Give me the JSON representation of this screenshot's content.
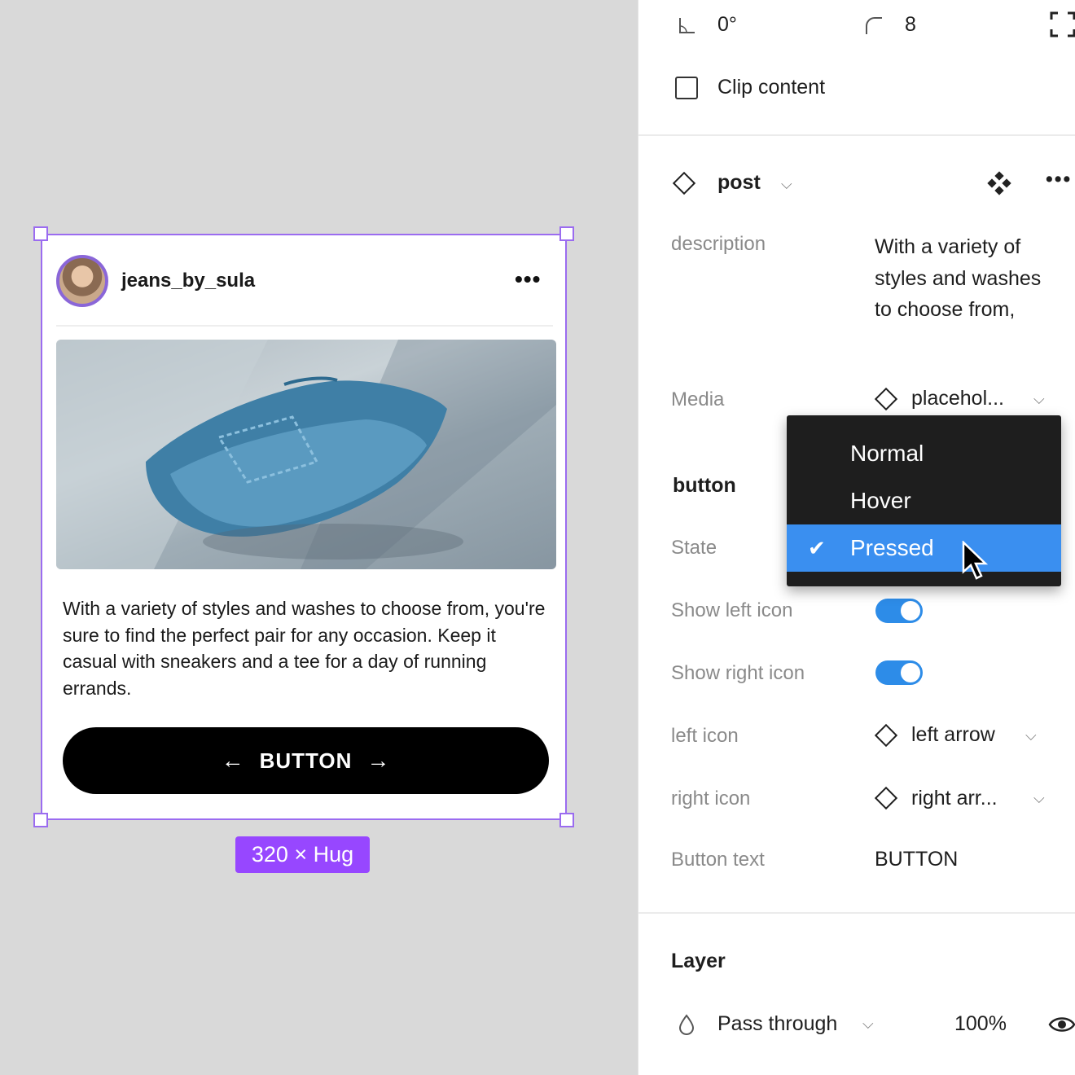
{
  "canvas": {
    "post": {
      "username": "jeans_by_sula",
      "more_icon": "more-horizontal-icon",
      "caption": "With a variety of styles and washes to choose from, you're sure to find the perfect pair for any occasion. Keep it casual with sneakers and a tee for a day of running errands.",
      "button": {
        "left_icon": "←",
        "label": "BUTTON",
        "right_icon": "→"
      }
    },
    "size_badge": "320 × Hug",
    "selection_color": "#9b6cf0"
  },
  "panel": {
    "rotation": "0°",
    "corner_radius": "8",
    "clip_content": {
      "label": "Clip content",
      "checked": false
    },
    "component": {
      "name": "post",
      "properties": {
        "description": {
          "label": "description",
          "value": "With a variety of styles and washes to choose from,"
        },
        "media": {
          "label": "Media",
          "value": "placehol..."
        }
      }
    },
    "button_section": {
      "title": "button",
      "state": {
        "label": "State"
      },
      "show_left_icon": {
        "label": "Show left icon",
        "on": true
      },
      "show_right_icon": {
        "label": "Show right icon",
        "on": true
      },
      "left_icon": {
        "label": "left icon",
        "value": "left arrow"
      },
      "right_icon": {
        "label": "right icon",
        "value": "right arr..."
      },
      "button_text": {
        "label": "Button text",
        "value": "BUTTON"
      }
    },
    "layer": {
      "title": "Layer",
      "blend_mode": "Pass through",
      "opacity": "100%"
    }
  },
  "state_dropdown": {
    "options": [
      "Normal",
      "Hover",
      "Pressed"
    ],
    "selected": "Pressed",
    "check": "✔"
  },
  "colors": {
    "accent": "#3a8ff0",
    "toggle": "#2d8ce8",
    "badge": "#9747ff"
  }
}
